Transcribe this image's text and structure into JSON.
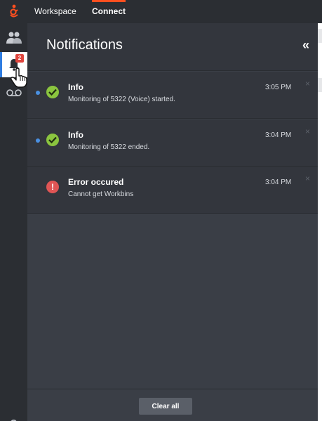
{
  "topbar": {
    "logo_icon": "genesys-logo-icon",
    "nav": [
      {
        "label": "Workspace"
      },
      {
        "label": "Connect"
      }
    ],
    "accent_color": "#ff4f1f"
  },
  "rail": {
    "items": [
      {
        "icon": "team-icon"
      },
      {
        "icon": "bell-icon",
        "badge": "2",
        "active": true
      },
      {
        "icon": "voicemail-icon"
      }
    ],
    "help_label": "?"
  },
  "panel": {
    "title": "Notifications",
    "collapse_label": "«",
    "notifications": [
      {
        "type": "success",
        "title": "Info",
        "message": "Monitoring of 5322 (Voice) started.",
        "time": "3:05 PM",
        "unread": true
      },
      {
        "type": "success",
        "title": "Info",
        "message": "Monitoring of 5322 ended.",
        "time": "3:04 PM",
        "unread": true
      },
      {
        "type": "error",
        "title": "Error occured",
        "message": "Cannot get Workbins",
        "time": "3:04 PM",
        "unread": false
      }
    ],
    "close_label": "×",
    "clear_all_label": "Clear all"
  },
  "colors": {
    "success": "#8bc53f",
    "error": "#e05555",
    "unread_dot": "#4a90e2",
    "badge": "#e0453d"
  }
}
